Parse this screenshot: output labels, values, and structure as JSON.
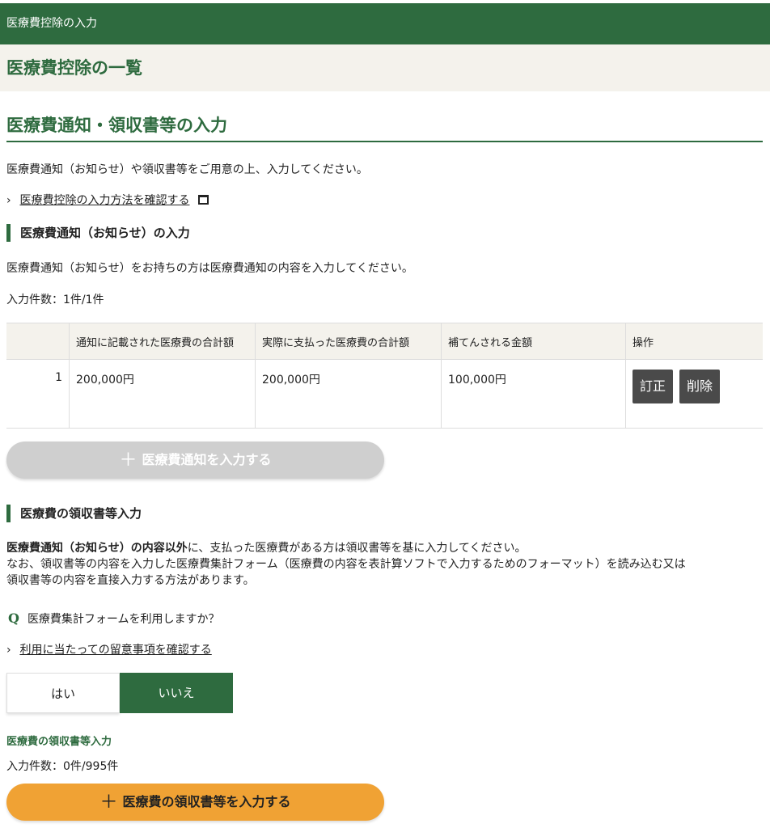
{
  "header": {
    "topbar_title": "医療費控除の入力",
    "page_title": "医療費控除の一覧"
  },
  "section": {
    "title": "医療費通知・領収書等の入力",
    "intro": "医療費通知（お知らせ）や領収書等をご用意の上、入力してください。",
    "howto_link": "医療費控除の入力方法を確認する"
  },
  "notice": {
    "heading": "医療費通知（お知らせ）の入力",
    "description": "医療費通知（お知らせ）をお持ちの方は医療費通知の内容を入力してください。",
    "count": "入力件数：1件/1件",
    "columns": [
      "",
      "通知に記載された医療費の合計額",
      "実際に支払った医療費の合計額",
      "補てんされる金額",
      "操作"
    ],
    "rows": [
      {
        "no": "1",
        "notified_total": "200,000円",
        "paid_total": "200,000円",
        "reimbursed": "100,000円"
      }
    ],
    "edit_label": "訂正",
    "delete_label": "削除",
    "add_button": "医療費通知を入力する"
  },
  "receipts": {
    "heading": "医療費の領収書等入力",
    "desc_bold": "医療費通知（お知らせ）の内容以外",
    "desc_rest": "に、支払った医療費がある方は領収書等を基に入力してください。",
    "desc_line2": "なお、領収書等の内容を入力した医療費集計フォーム（医療費の内容を表計算ソフトで入力するためのフォーマット）を読み込む又は",
    "desc_line3": "領収書等の内容を直接入力する方法があります。",
    "question_mark": "Q",
    "question": "医療費集計フォームを利用しますか？",
    "notes_link": "利用に当たっての留意事項を確認する",
    "option_yes": "はい",
    "option_no": "いいえ",
    "selected_option": "いいえ",
    "sub_label": "医療費の領収書等入力",
    "count": "入力件数：0件/995件",
    "add_button": "医療費の領収書等を入力する"
  },
  "colors": {
    "brand_green": "#2e6b3f",
    "header_beige": "#f4f2ec",
    "disabled_gray": "#cfcfcf",
    "accent_orange": "#f0a234",
    "action_dark": "#4a4a4a"
  },
  "icons": {
    "chevron": "chevron-right-icon",
    "external": "external-window-icon",
    "plus": "plus-icon"
  }
}
